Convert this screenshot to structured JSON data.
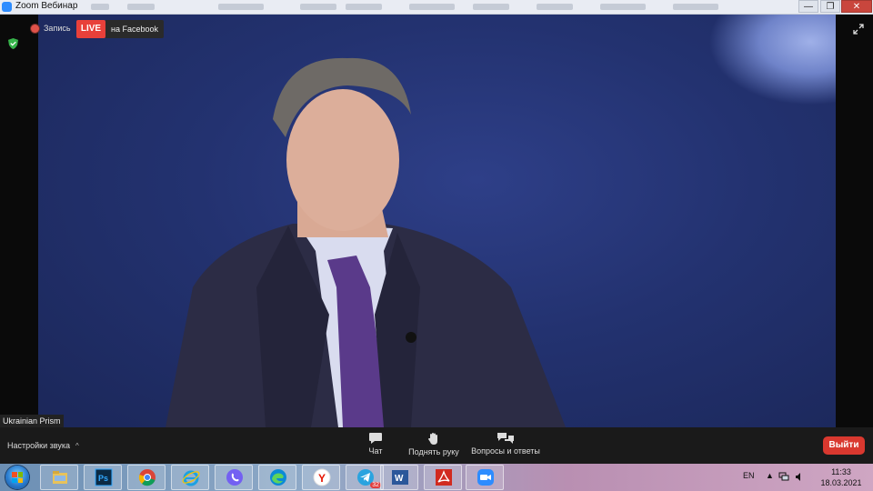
{
  "window": {
    "title": "Zoom Вебинар",
    "min_label": "—",
    "max_label": "❐",
    "close_label": "✕"
  },
  "top_bar": {
    "record_label": "Запись",
    "live_label": "LIVE",
    "facebook_label": "на Facebook"
  },
  "speaker_name": "Ukrainian Prism",
  "toolbar": {
    "audio_settings_label": "Настройки звука",
    "chat_label": "Чат",
    "raise_hand_label": "Поднять руку",
    "qa_label": "Вопросы и ответы",
    "leave_label": "Выйти"
  },
  "taskbar": {
    "apps": [
      "explorer-icon",
      "photoshop-icon",
      "chrome-icon",
      "ie-icon",
      "viber-icon",
      "edge-icon",
      "yandex-icon",
      "telegram-icon",
      "word-icon",
      "acrobat-icon",
      "zoom-icon"
    ],
    "telegram_badge": "32",
    "language": "EN",
    "time": "11:33",
    "date": "18.03.2021"
  },
  "colors": {
    "live_red": "#e8403a",
    "leave_red": "#d9382f",
    "zoom_blue": "#2d8cff",
    "backdrop_blue": "#233270"
  }
}
